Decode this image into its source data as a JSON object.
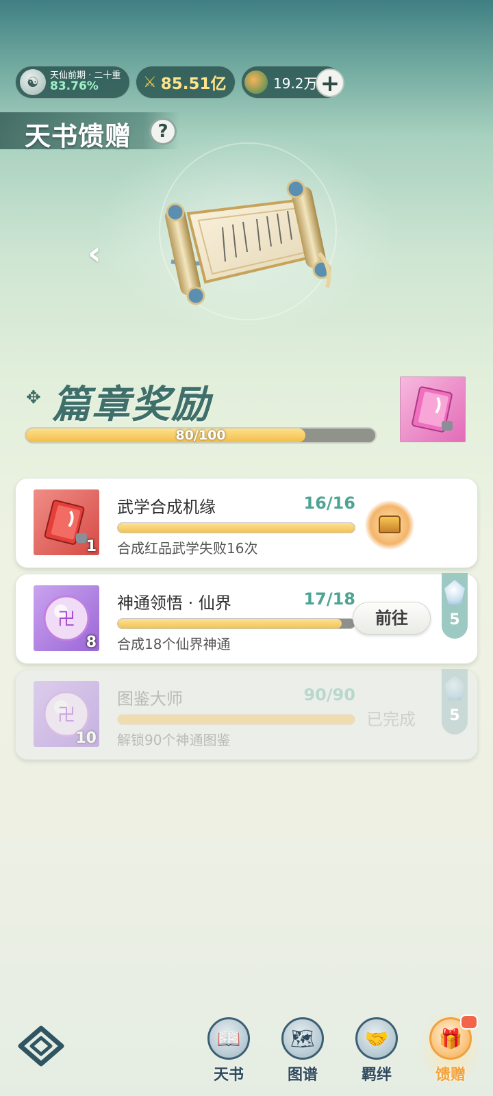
{
  "header": {
    "realm": {
      "name": "天仙前期 · 二十重",
      "percent": "83.76%",
      "icon": "immortal-avatar-icon"
    },
    "power": {
      "value": "85.51亿",
      "icon": "crossed-swords-icon"
    },
    "jade": {
      "value": "19.2万",
      "icon": "jade-coin-icon"
    },
    "add_label": "+"
  },
  "page": {
    "title": "天书馈赠",
    "help_label": "?",
    "back_label": "‹"
  },
  "chapter": {
    "title": "篇章奖励",
    "progress_text": "80/100",
    "progress_value": 80,
    "progress_max": 100,
    "reward_icon": "pink-book-icon"
  },
  "tasks": [
    {
      "name": "武学合成机缘",
      "progress": "16/16",
      "fraction": 1.0,
      "desc": "合成红品武学失败16次",
      "icon": "red-book-icon",
      "icon_count": "1",
      "action": "treasure-chest",
      "reward_count": ""
    },
    {
      "name": "神通领悟 · 仙界",
      "progress": "17/18",
      "fraction": 0.944,
      "desc": "合成18个仙界神通",
      "icon": "purple-orb-icon",
      "icon_count": "8",
      "action_label": "前往",
      "reward_count": "5"
    },
    {
      "name": "图鉴大师",
      "progress": "90/90",
      "fraction": 1.0,
      "desc": "解锁90个神通图鉴",
      "icon": "purple-orb-icon",
      "icon_count": "10",
      "status_label": "已完成",
      "reward_count": "5"
    }
  ],
  "nav": {
    "items": [
      {
        "label": "天书",
        "icon": "scroll-book-icon",
        "glyph": "📖"
      },
      {
        "label": "图谱",
        "icon": "atlas-map-icon",
        "glyph": "🗺"
      },
      {
        "label": "羁绊",
        "icon": "handshake-icon",
        "glyph": "🤝"
      },
      {
        "label": "馈赠",
        "icon": "gift-bag-icon",
        "glyph": "🎁"
      }
    ]
  },
  "colors": {
    "accent_teal": "#4ea494",
    "progress_gold": "#f1be4b",
    "active_orange": "#f3a23a"
  }
}
